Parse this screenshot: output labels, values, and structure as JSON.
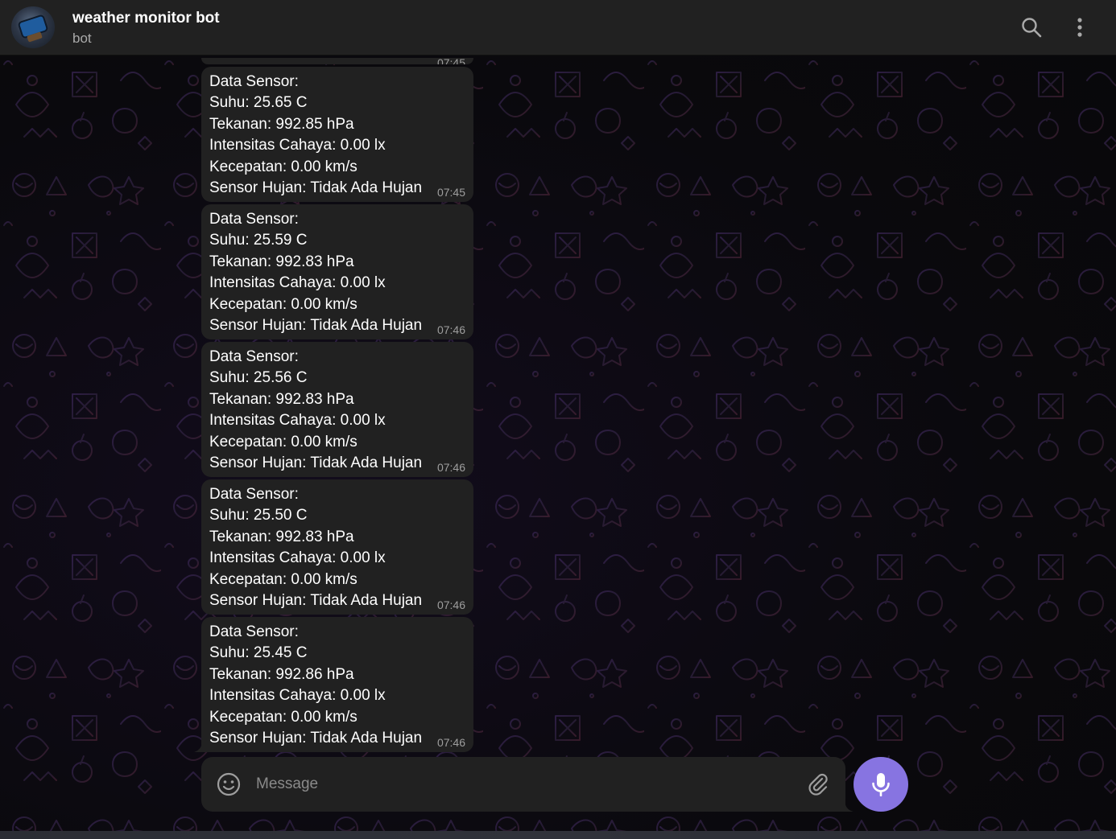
{
  "header": {
    "title": "weather monitor bot",
    "status": "bot",
    "avatar_icon": "bot-avatar",
    "search_icon": "search-icon",
    "menu_icon": "more-vertical-icon"
  },
  "partial_message": {
    "time": "07:45"
  },
  "messages": [
    {
      "lines": [
        "Data Sensor:",
        "Suhu: 25.65 C",
        "Tekanan: 992.85 hPa",
        "Intensitas Cahaya: 0.00 lx",
        "Kecepatan: 0.00 km/s",
        "Sensor Hujan: Tidak Ada Hujan"
      ],
      "time": "07:45"
    },
    {
      "lines": [
        "Data Sensor:",
        "Suhu: 25.59 C",
        "Tekanan: 992.83 hPa",
        "Intensitas Cahaya: 0.00 lx",
        "Kecepatan: 0.00 km/s",
        "Sensor Hujan: Tidak Ada Hujan"
      ],
      "time": "07:46"
    },
    {
      "lines": [
        "Data Sensor:",
        "Suhu: 25.56 C",
        "Tekanan: 992.83 hPa",
        "Intensitas Cahaya: 0.00 lx",
        "Kecepatan: 0.00 km/s",
        "Sensor Hujan: Tidak Ada Hujan"
      ],
      "time": "07:46"
    },
    {
      "lines": [
        "Data Sensor:",
        "Suhu: 25.50 C",
        "Tekanan: 992.83 hPa",
        "Intensitas Cahaya: 0.00 lx",
        "Kecepatan: 0.00 km/s",
        "Sensor Hujan: Tidak Ada Hujan"
      ],
      "time": "07:46"
    },
    {
      "lines": [
        "Data Sensor:",
        "Suhu: 25.45 C",
        "Tekanan: 992.86 hPa",
        "Intensitas Cahaya: 0.00 lx",
        "Kecepatan: 0.00 km/s",
        "Sensor Hujan: Tidak Ada Hujan"
      ],
      "time": "07:46"
    }
  ],
  "composer": {
    "placeholder": "Message",
    "value": "",
    "emoji_icon": "emoji-icon",
    "attach_icon": "paperclip-icon",
    "mic_icon": "microphone-icon"
  },
  "colors": {
    "accent": "#8774e1",
    "bubble": "#212121",
    "header": "#212121",
    "background": "#0b0a0f"
  }
}
